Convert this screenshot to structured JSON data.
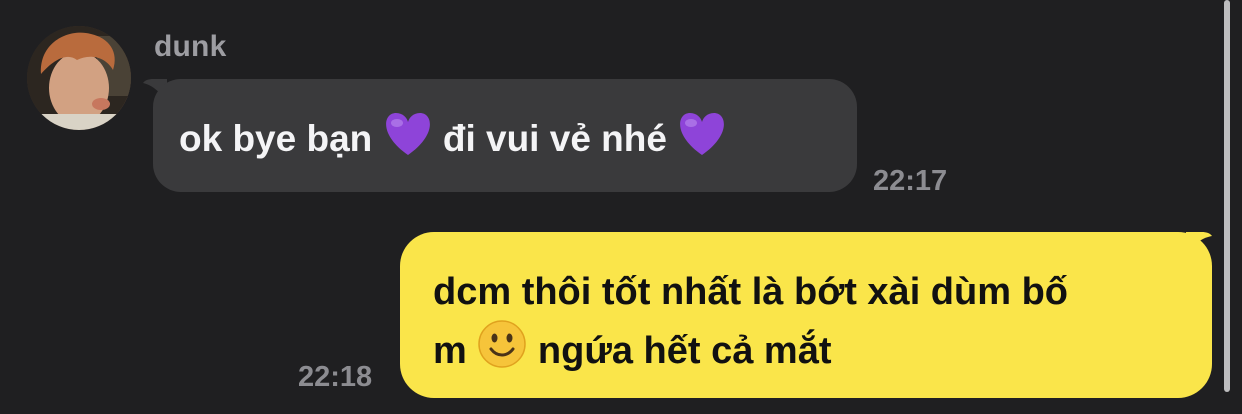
{
  "conversation": {
    "incoming": {
      "sender": "dunk",
      "text_part1": "ok bye bạn",
      "text_part2": "đi vui vẻ nhé",
      "emoji": "purple-heart",
      "time": "22:17"
    },
    "outgoing": {
      "line1": "dcm thôi tốt nhất là bớt xài dùm bố",
      "line2_prefix": "m",
      "line2_emoji": "slightly-smiling-face",
      "line2_suffix": "ngứa hết cả mắt",
      "time": "22:18"
    }
  },
  "colors": {
    "background": "#1f1f21",
    "incoming_bubble": "#3a3a3c",
    "outgoing_bubble": "#fae54a",
    "name_text": "#9d9da2",
    "timestamp": "#8c8c91",
    "emoji_heart": "#8e44d9"
  }
}
